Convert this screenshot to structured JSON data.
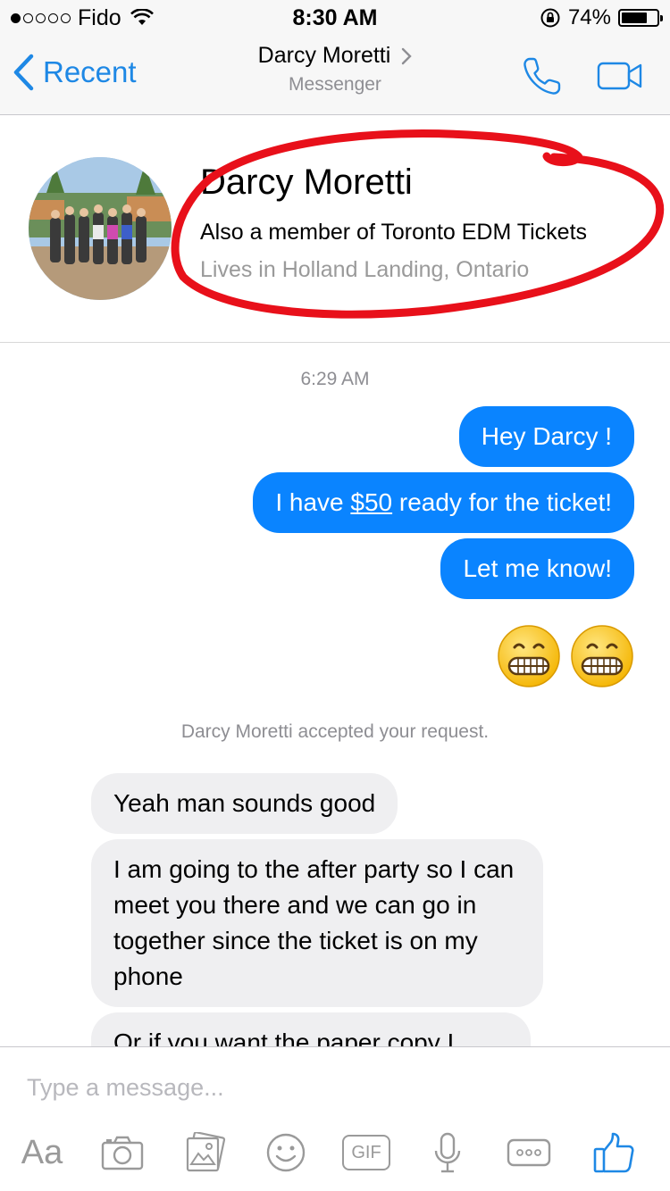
{
  "status_bar": {
    "carrier": "Fido",
    "signal_filled": 1,
    "signal_total": 5,
    "time": "8:30 AM",
    "battery_text": "74%",
    "battery_level": 0.74
  },
  "nav": {
    "back_label": "Recent",
    "title": "Darcy Moretti",
    "subtitle": "Messenger",
    "icons": [
      "phone-icon",
      "video-camera-icon"
    ]
  },
  "profile": {
    "name": "Darcy Moretti",
    "line1": "Also a member of Toronto EDM Tickets",
    "line2": "Lives in Holland Landing, Ontario"
  },
  "chat": {
    "timestamp": "6:29 AM",
    "outgoing": [
      {
        "text": "Hey Darcy !"
      },
      {
        "pre": "I have ",
        "link": "$50",
        "post": " ready for the ticket!"
      },
      {
        "text": "Let me know!"
      }
    ],
    "emojis": [
      "grimacing-face-emoji",
      "grimacing-face-emoji"
    ],
    "system_message": "Darcy Moretti accepted your request.",
    "incoming": [
      "Yeah man sounds good",
      "I am going to the after party so I can meet you there and we can go in together since the ticket is on my phone",
      "Or if you want the paper copy I"
    ]
  },
  "composer": {
    "placeholder": "Type a message...",
    "aa_label": "Aa",
    "gif_label": "GIF",
    "tools": [
      "text-format-icon",
      "camera-icon",
      "photo-gallery-icon",
      "sticker-smiley-icon",
      "gif-icon",
      "microphone-icon",
      "more-icon",
      "thumbs-up-icon"
    ]
  },
  "colors": {
    "accent": "#1e88e5",
    "outgoing_bubble": "#0a84ff",
    "incoming_bubble": "#efeff1",
    "annotation": "#e8101a"
  }
}
